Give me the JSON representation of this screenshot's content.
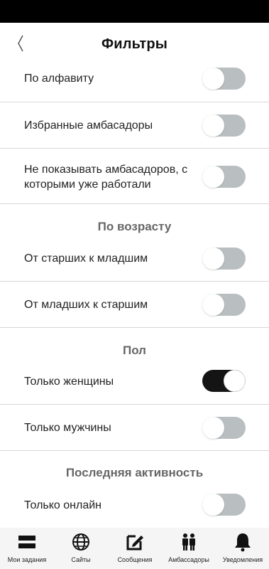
{
  "header": {
    "title": "Фильтры"
  },
  "filters": {
    "alphabet": {
      "label": "По алфавиту",
      "on": false
    },
    "favorites": {
      "label": "Избранные амбасадоры",
      "on": false
    },
    "hide_worked": {
      "label_line1": "Не показывать амбасадоров, с",
      "label_line2": "которыми уже работали",
      "on": false
    }
  },
  "age": {
    "title": "По возрасту",
    "older_first": {
      "label": "От старших к младшим",
      "on": false
    },
    "younger_first": {
      "label": "От младших к старшим",
      "on": false
    }
  },
  "gender": {
    "title": "Пол",
    "women_only": {
      "label": "Только женщины",
      "on": true
    },
    "men_only": {
      "label": "Только мужчины",
      "on": false
    }
  },
  "activity": {
    "title": "Последняя активность",
    "online_only": {
      "label": "Только онлайн",
      "on": false
    }
  },
  "nav": [
    {
      "label": "Мои задания",
      "icon": "tasks-icon"
    },
    {
      "label": "Сайты",
      "icon": "globe-icon"
    },
    {
      "label": "Сообщения",
      "icon": "edit-icon"
    },
    {
      "label": "Амбассадоры",
      "icon": "people-icon"
    },
    {
      "label": "Уведомления",
      "icon": "bell-icon"
    }
  ]
}
